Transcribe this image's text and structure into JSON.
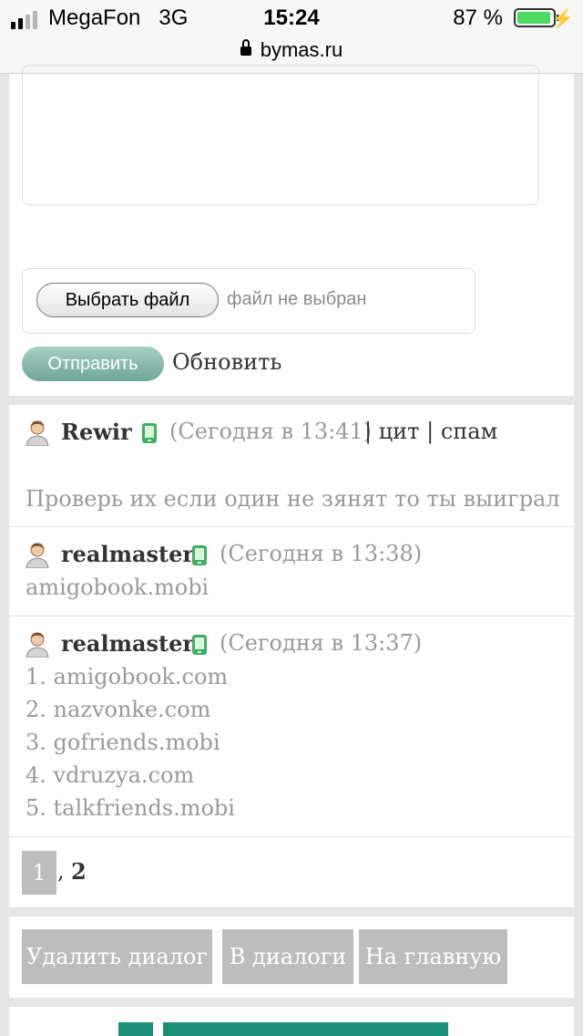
{
  "status_bar": {
    "carrier": "MegaFon",
    "network": "3G",
    "time": "15:24",
    "battery_percent": "87 %",
    "url": "bymas.ru"
  },
  "form": {
    "file_button": "Выбрать файл",
    "file_status": "файл не выбран",
    "send_button": "Отправить",
    "refresh_link": "Обновить"
  },
  "messages": [
    {
      "user": "Rewir",
      "time": "(Сегодня в 13:41)",
      "sep1": "|",
      "quote": "цит",
      "sep2": "|",
      "spam": "спам",
      "text": "Проверь их если один не зянят то ты выиграл"
    },
    {
      "user": "realmaster",
      "time": "(Сегодня в 13:38)",
      "text": "amigobook.mobi"
    },
    {
      "user": "realmaster",
      "time": "(Сегодня в 13:37)",
      "lines": [
        "1. amigobook.com",
        "2. nazvonke.com",
        "3. gofriends.mobi",
        "4. vdruzya.com",
        "5. talkfriends.mobi"
      ]
    }
  ],
  "pagination": {
    "current": "1",
    "separator": ",",
    "next": "2"
  },
  "actions": {
    "delete": "Удалить диалог",
    "dialogs": "В диалоги",
    "home": "На главную"
  },
  "colors": {
    "accent_green": "#1a8f76",
    "button_gray": "#bdbdbd",
    "send_button": "#8fbcb0"
  }
}
